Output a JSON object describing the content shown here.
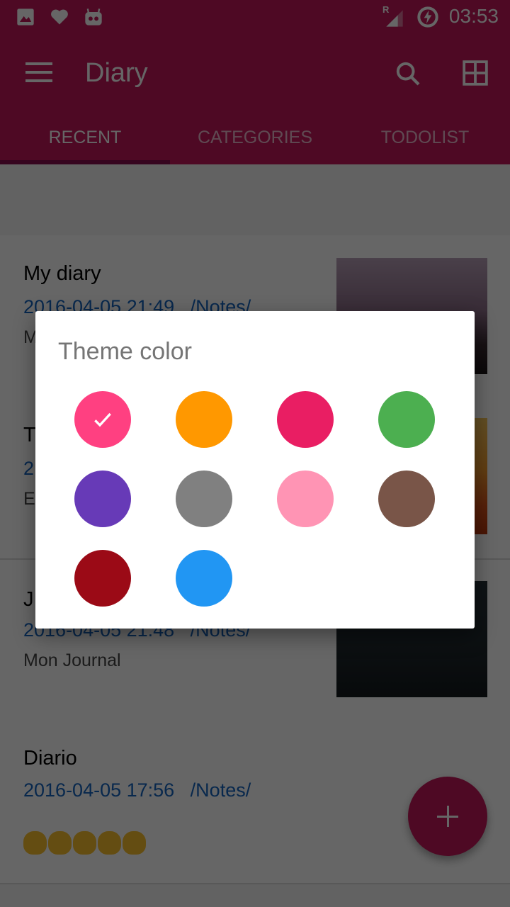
{
  "status_bar": {
    "left_icons": [
      "gallery-icon",
      "heart-icon",
      "cyanogen-icon"
    ],
    "roaming_label": "R",
    "time": "03:53"
  },
  "app_bar": {
    "title": "Diary",
    "menu_icon": "hamburger-menu-icon",
    "actions": [
      "search-icon",
      "grid-view-icon"
    ]
  },
  "tabs": [
    {
      "label": "RECENT",
      "active": true
    },
    {
      "label": "CATEGORIES",
      "active": false
    },
    {
      "label": "TODOLIST",
      "active": false
    }
  ],
  "entries": [
    {
      "title": "My diary",
      "meta": "2016-04-05 21:49   /Notes/",
      "snippet": "M"
    },
    {
      "title": "T",
      "meta": "2",
      "snippet": "E"
    },
    {
      "title": "J",
      "meta": "2016-04-05 21:48   /Notes/",
      "snippet": "Mon Journal"
    },
    {
      "title": "Diario",
      "meta": "2016-04-05 17:56   /Notes/",
      "snippet": "😘😍😆😇😁"
    }
  ],
  "fab": {
    "icon": "plus-icon"
  },
  "dialog": {
    "title": "Theme color",
    "selected_index": 0,
    "colors": [
      {
        "name": "pink",
        "hex": "#ff4081"
      },
      {
        "name": "orange",
        "hex": "#ff9800"
      },
      {
        "name": "crimson",
        "hex": "#e91e63"
      },
      {
        "name": "green",
        "hex": "#4caf50"
      },
      {
        "name": "purple",
        "hex": "#673ab7"
      },
      {
        "name": "gray",
        "hex": "#808080"
      },
      {
        "name": "light-pink",
        "hex": "#ff94b4"
      },
      {
        "name": "brown",
        "hex": "#795548"
      },
      {
        "name": "dark-red",
        "hex": "#9b0a16"
      },
      {
        "name": "blue",
        "hex": "#2196f3"
      }
    ]
  },
  "colors": {
    "primary": "#c2185b",
    "primary_dark": "#880e4f",
    "meta_text": "#1565c0"
  }
}
